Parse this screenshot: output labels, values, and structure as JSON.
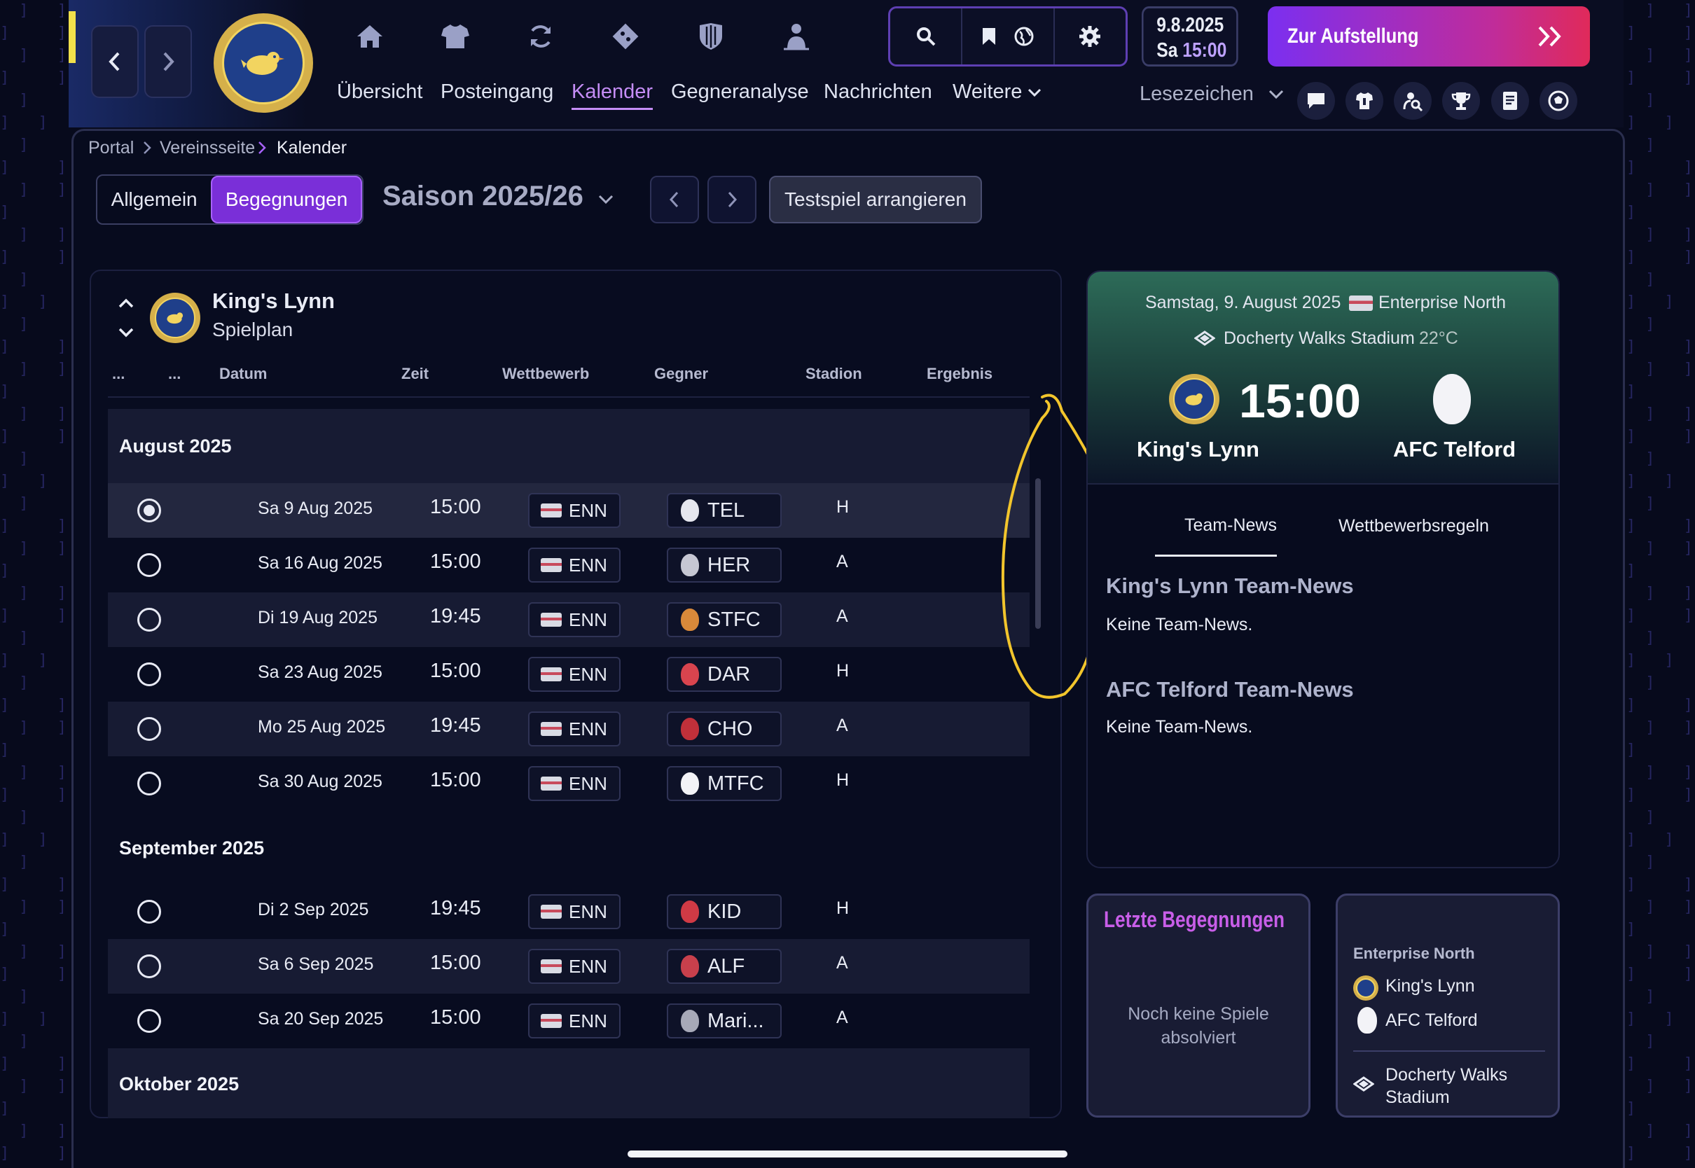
{
  "nav": {
    "items": [
      "Übersicht",
      "Posteingang",
      "Kalender",
      "Gegneranalyse",
      "Nachrichten",
      "Weitere"
    ]
  },
  "topbar": {
    "date": "9.8.2025",
    "weekday": "Sa",
    "time": "15:00",
    "cta_label": "Zur Aufstellung",
    "bookmarks_label": "Lesezeichen"
  },
  "icons": {
    "top": [
      "home-icon",
      "shirt-icon",
      "refresh-icon",
      "tactics-icon",
      "shield-icon",
      "person-icon"
    ],
    "tools": [
      "search-icon",
      "bookmark-icon",
      "globe-icon",
      "gear-icon"
    ],
    "right": [
      "chat-icon",
      "kit-icon",
      "scout-icon",
      "trophy-icon",
      "notes-icon",
      "ball-icon"
    ]
  },
  "breadcrumb": [
    "Portal",
    "Vereinsseite",
    "Kalender"
  ],
  "view_tabs": [
    "Allgemein",
    "Begegnungen"
  ],
  "season": "Saison 2025/26",
  "friendly_button": "Testspiel arrangieren",
  "schedule": {
    "team": "King's Lynn",
    "subtitle": "Spielplan",
    "columns": [
      "...",
      "...",
      "Datum",
      "Zeit",
      "Wettbewerb",
      "Gegner",
      "Stadion",
      "Ergebnis"
    ],
    "months": [
      {
        "label": "August 2025",
        "rows": [
          {
            "date": "Sa 9 Aug 2025",
            "time": "15:00",
            "comp": "ENN",
            "opp": "TEL",
            "venue": "H",
            "selected": true
          },
          {
            "date": "Sa 16 Aug 2025",
            "time": "15:00",
            "comp": "ENN",
            "opp": "HER",
            "venue": "A"
          },
          {
            "date": "Di 19 Aug 2025",
            "time": "19:45",
            "comp": "ENN",
            "opp": "STFC",
            "venue": "A"
          },
          {
            "date": "Sa 23 Aug 2025",
            "time": "15:00",
            "comp": "ENN",
            "opp": "DAR",
            "venue": "H"
          },
          {
            "date": "Mo 25 Aug 2025",
            "time": "19:45",
            "comp": "ENN",
            "opp": "CHO",
            "venue": "A"
          },
          {
            "date": "Sa 30 Aug 2025",
            "time": "15:00",
            "comp": "ENN",
            "opp": "MTFC",
            "venue": "H"
          }
        ]
      },
      {
        "label": "September 2025",
        "rows": [
          {
            "date": "Di 2 Sep 2025",
            "time": "19:45",
            "comp": "ENN",
            "opp": "KID",
            "venue": "H"
          },
          {
            "date": "Sa 6 Sep 2025",
            "time": "15:00",
            "comp": "ENN",
            "opp": "ALF",
            "venue": "A"
          },
          {
            "date": "Sa 20 Sep 2025",
            "time": "15:00",
            "comp": "ENN",
            "opp": "Mari...",
            "venue": "A"
          }
        ]
      },
      {
        "label": "Oktober 2025",
        "rows": []
      }
    ]
  },
  "match": {
    "date": "Samstag, 9. August 2025",
    "competition": "Enterprise North",
    "stadium": "Docherty Walks Stadium",
    "temperature": "22°C",
    "kickoff": "15:00",
    "home": "King's Lynn",
    "away": "AFC Telford",
    "tabs": [
      "Team-News",
      "Wettbewerbsregeln"
    ],
    "home_news_title": "King's Lynn Team-News",
    "home_news": "Keine Team-News.",
    "away_news_title": "AFC Telford Team-News",
    "away_news": "Keine Team-News."
  },
  "last_meetings": {
    "title": "Letzte Begegnungen",
    "empty": "Noch keine Spiele absolviert"
  },
  "fixture_card": {
    "competition": "Enterprise North",
    "home": "King's Lynn",
    "away": "AFC Telford",
    "stadium": "Docherty Walks Stadium"
  },
  "colors": {
    "accent": "#a862ff",
    "cta_start": "#7b2ff0",
    "cta_end": "#e02a5a",
    "highlight": "#f2c52c",
    "pitch": "#2d6b58"
  }
}
